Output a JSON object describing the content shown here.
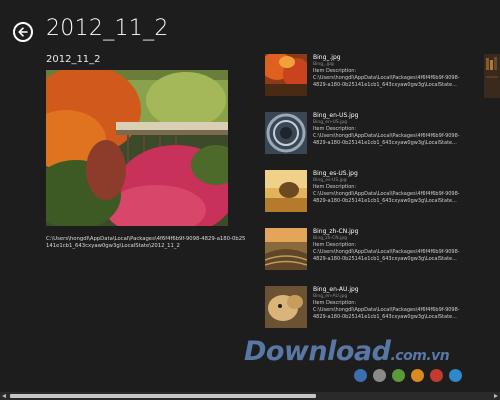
{
  "header": {
    "title": "2012_11_2",
    "back_icon": "back-arrow-icon"
  },
  "group": {
    "title": "2012_11_2",
    "path": "C:\\Users\\hongdl\\AppData\\Local\\Packages\\4f6f4f6b9f-9098-4829-a180-0b25141e1cb1_643cxyaw0gw3g\\LocalState\\2012_11_2"
  },
  "items": [
    {
      "title": "Bing_.jpg",
      "subtitle": "Bing_.jpg",
      "description": "Item Description: C:\\Users\\hongdl\\AppData\\Local\\Packages\\4f6f4f6b9f-9098-4829-a180-0b25141e1cb1_643cxyaw0gw3g\\LocalState..."
    },
    {
      "title": "Bing_en-US.jpg",
      "subtitle": "Bing_en-US.jpg",
      "description": "Item Description: C:\\Users\\hongdl\\AppData\\Local\\Packages\\4f6f4f6b9f-9098-4829-a180-0b25141e1cb1_643cxyaw0gw3g\\LocalState..."
    },
    {
      "title": "Bing_es-US.jpg",
      "subtitle": "Bing_es-US.jpg",
      "description": "Item Description: C:\\Users\\hongdl\\AppData\\Local\\Packages\\4f6f4f6b9f-9098-4829-a180-0b25141e1cb1_643cxyaw0gw3g\\LocalState..."
    },
    {
      "title": "Bing_zh-CN.jpg",
      "subtitle": "Bing_zh-CN.jpg",
      "description": "Item Description: C:\\Users\\hongdl\\AppData\\Local\\Packages\\4f6f4f6b9f-9098-4829-a180-0b25141e1cb1_643cxyaw0gw3g\\LocalState..."
    },
    {
      "title": "Bing_en-AU.jpg",
      "subtitle": "Bing_en-AU.jpg",
      "description": "Item Description: C:\\Users\\hongdl\\AppData\\Local\\Packages\\4f6f4f6b9f-9098-4829-a180-0b25141e1cb1_643cxyaw0gw3g\\LocalState..."
    }
  ],
  "watermark": {
    "text": "Download",
    "suffix": ".com.vn",
    "dot_colors": [
      "#3c6fb0",
      "#8a8a8a",
      "#5b9a3a",
      "#d98a1e",
      "#c53a2e",
      "#2f88c9"
    ]
  },
  "colors": {
    "background": "#1d1d1d",
    "text": "#ffffff",
    "secondary_text": "#8f8f8f"
  }
}
